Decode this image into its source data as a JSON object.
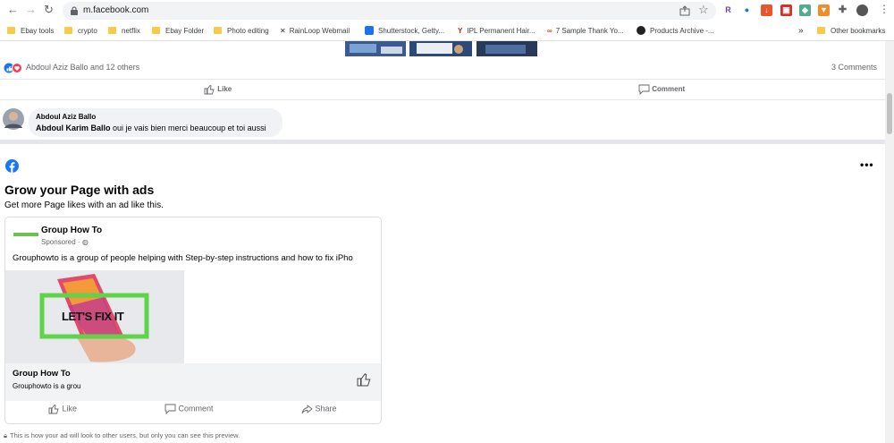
{
  "browser": {
    "url": "m.facebook.com",
    "bookmarks": [
      {
        "label": "Ebay tools",
        "type": "folder"
      },
      {
        "label": "crypto",
        "type": "folder"
      },
      {
        "label": "netflix",
        "type": "folder"
      },
      {
        "label": "Ebay Folder",
        "type": "folder"
      },
      {
        "label": "Photo editing",
        "type": "folder"
      },
      {
        "label": "RainLoop Webmail",
        "type": "link"
      },
      {
        "label": "Shutterstock, Getty...",
        "type": "link"
      },
      {
        "label": "IPL Permanent Hair...",
        "type": "link"
      },
      {
        "label": "7 Sample Thank Yo...",
        "type": "link"
      },
      {
        "label": "Products Archive -...",
        "type": "link"
      }
    ],
    "overflow": "»",
    "other_bookmarks": "Other bookmarks"
  },
  "post": {
    "reactions_text": "Abdoul Aziz Ballo and 12 others",
    "comments_count": "3 Comments",
    "like_label": "Like",
    "comment_label": "Comment"
  },
  "comment": {
    "author": "Abdoul Aziz Ballo",
    "mention": "Abdoul Karim Ballo",
    "text": " oui je vais bien merci beaucoup et toi aussi"
  },
  "ad_preview": {
    "title": "Grow your Page with ads",
    "subtitle": "Get more Page likes with an ad like this.",
    "page_name": "Group How To",
    "sponsored": "Sponsored · ",
    "description": "Grouphowto is a group of people helping with Step-by-step instructions and how to fix iPho",
    "image_text": "LET'S FIX IT",
    "footer_name": "Group How To",
    "footer_sub": "Grouphowto is a grou",
    "actions": {
      "like": "Like",
      "comment": "Comment",
      "share": "Share"
    },
    "notice": "This is how your ad will look to other users, but only you can see this preview."
  },
  "colors": {
    "facebook_blue": "#1877f2",
    "ad_border_green": "#5fd34a",
    "folder_yellow": "#f8c94a"
  }
}
